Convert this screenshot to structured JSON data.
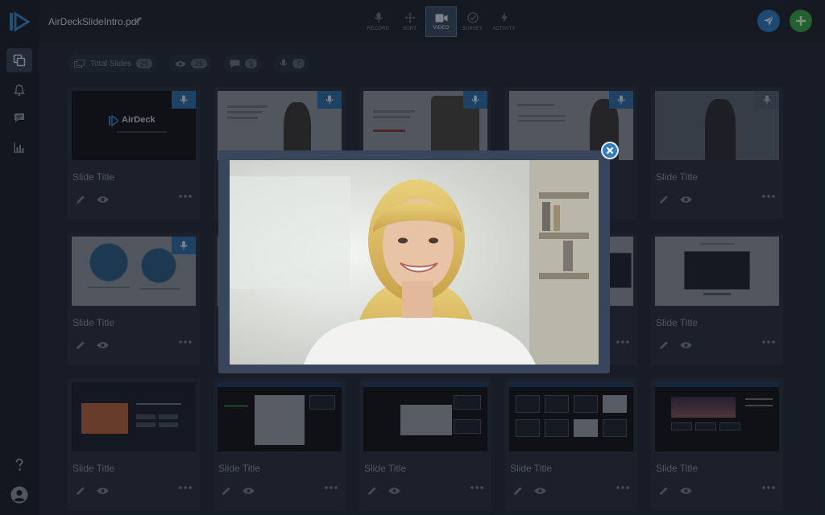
{
  "app": {
    "filename": "AirDeckSlideIntro.pdf"
  },
  "toolbar": {
    "tools": [
      {
        "label": "RECORD",
        "icon": "microphone-icon"
      },
      {
        "label": "SORT",
        "icon": "move-arrows-icon"
      },
      {
        "label": "VIDEO",
        "icon": "video-camera-icon",
        "active": true
      },
      {
        "label": "SURVEY",
        "icon": "check-gauge-icon"
      },
      {
        "label": "ACTIVITY",
        "icon": "lightning-icon"
      }
    ],
    "send_icon": "paper-plane-icon",
    "add_icon": "plus-icon"
  },
  "stats": {
    "total_label": "Total Slides",
    "total_count": "25",
    "views_count": "25",
    "comments_count": "1",
    "recordings_count": "7"
  },
  "slides": {
    "title": "Slide Title",
    "thumb_logo": "AirDeck"
  },
  "modal": {
    "close_icon": "close-x-icon"
  },
  "colors": {
    "accent": "#2f7fc1",
    "add": "#3aa845",
    "background": "#232b38"
  }
}
